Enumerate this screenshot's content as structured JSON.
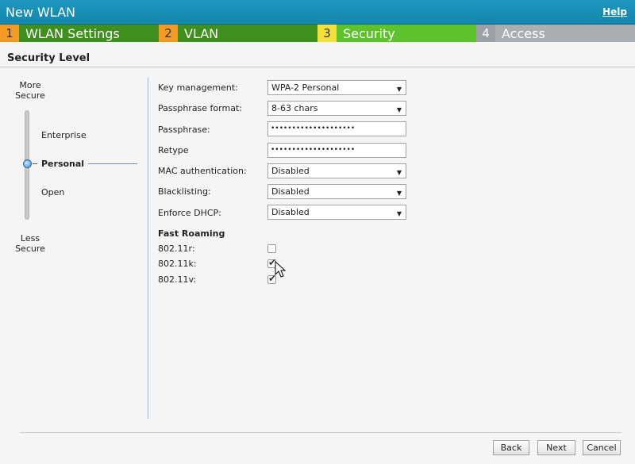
{
  "window": {
    "title": "New WLAN",
    "help_label": "Help"
  },
  "steps": [
    {
      "num": "1",
      "label": "WLAN Settings"
    },
    {
      "num": "2",
      "label": "VLAN"
    },
    {
      "num": "3",
      "label": "Security"
    },
    {
      "num": "4",
      "label": "Access"
    }
  ],
  "section_title": "Security Level",
  "security_level": {
    "more": "More Secure",
    "less": "Less Secure",
    "options": [
      "Enterprise",
      "Personal",
      "Open"
    ],
    "selected": "Personal"
  },
  "fields": {
    "key_management": {
      "label": "Key management:",
      "value": "WPA-2 Personal"
    },
    "passphrase_format": {
      "label": "Passphrase format:",
      "value": "8-63 chars"
    },
    "passphrase": {
      "label": "Passphrase:",
      "value": "••••••••••••••••••••"
    },
    "retype": {
      "label": "Retype",
      "value": "••••••••••••••••••••"
    },
    "mac_auth": {
      "label": "MAC authentication:",
      "value": "Disabled"
    },
    "blacklisting": {
      "label": "Blacklisting:",
      "value": "Disabled"
    },
    "enforce_dhcp": {
      "label": "Enforce DHCP:",
      "value": "Disabled"
    }
  },
  "fast_roaming": {
    "title": "Fast Roaming",
    "items": [
      {
        "label": "802.11r:",
        "checked": false
      },
      {
        "label": "802.11k:",
        "checked": true
      },
      {
        "label": "802.11v:",
        "checked": true
      }
    ]
  },
  "buttons": {
    "back": "Back",
    "next": "Next",
    "cancel": "Cancel"
  },
  "icons": {
    "dropdown": "chevron-down-icon",
    "check": "check-icon",
    "cursor": "mouse-pointer-icon"
  }
}
